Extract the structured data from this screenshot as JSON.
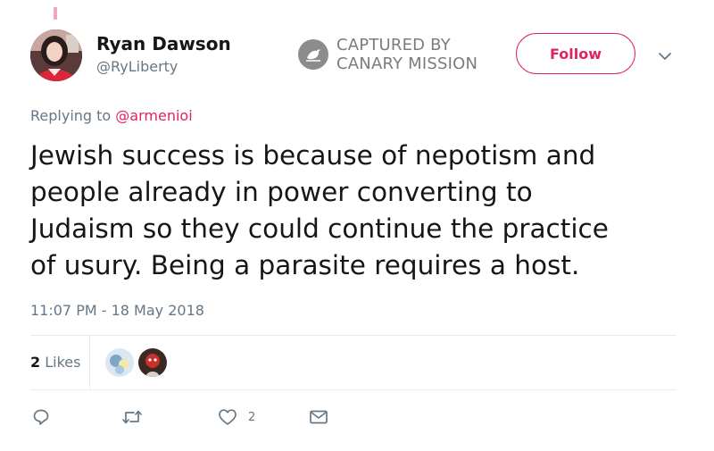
{
  "tweet": {
    "author": {
      "name": "Ryan Dawson",
      "handle": "@RyLiberty"
    },
    "reply_context": {
      "prefix": "Replying to",
      "mention": "@armenioi"
    },
    "text": "Jewish success is because of nepotism and\npeople already in power converting to\nJudaism so they could continue the practice\nof usury. Being a parasite requires a host.",
    "timestamp": "11:07 PM - 18 May 2018",
    "likes": {
      "count": "2",
      "label": "Likes"
    },
    "actions": {
      "like_count": "2"
    }
  },
  "header": {
    "follow_label": "Follow"
  },
  "watermark": {
    "line1": "CAPTURED BY",
    "line2": "CANARY MISSION"
  },
  "colors": {
    "accent": "#e0245e",
    "muted_text": "#657786",
    "body_text": "#14171a",
    "watermark": "#7c7c7c",
    "divider": "#e6ecf0"
  },
  "icons": {
    "reply": "reply-icon",
    "retweet": "retweet-icon",
    "like": "heart-icon",
    "direct_message": "envelope-icon",
    "more": "chevron-down-icon"
  }
}
